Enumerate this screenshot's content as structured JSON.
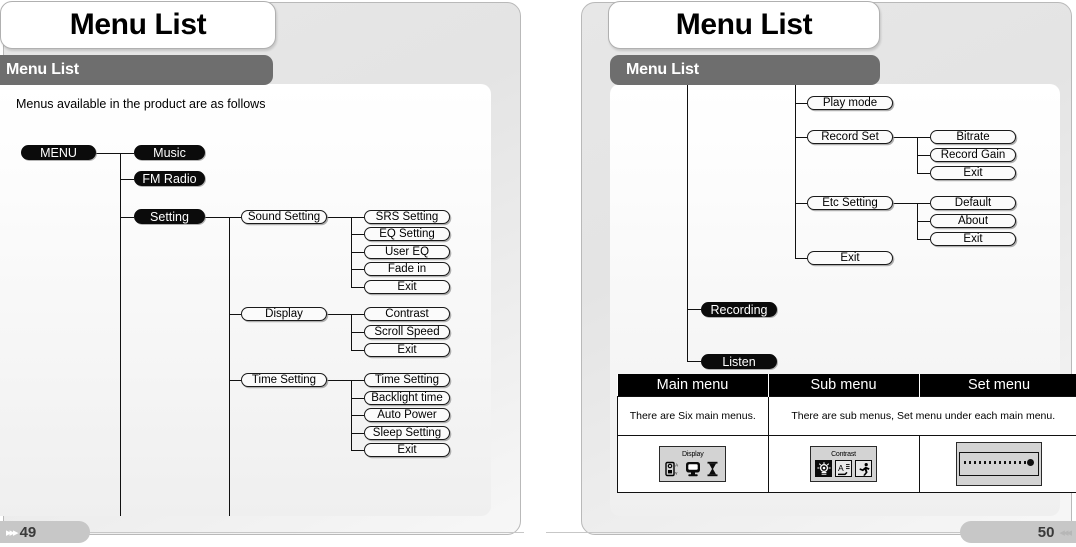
{
  "left_page": {
    "title": "Menu List",
    "section_header": "Menu List",
    "intro": "Menus available in the product are as follows",
    "folio": "49",
    "folio_arrows": "▸▸▸",
    "root": "MENU",
    "main_menus": [
      "Music",
      "FM Radio",
      "Setting"
    ],
    "sub_menus": [
      "Sound Setting",
      "Display",
      "Time Setting"
    ],
    "set_menus": {
      "sound_setting": [
        "SRS Setting",
        "EQ Setting",
        "User EQ",
        "Fade in",
        "Exit"
      ],
      "display": [
        "Contrast",
        "Scroll Speed",
        "Exit"
      ],
      "time_setting": [
        "Time Setting",
        "Backlight time",
        "Auto Power",
        "Sleep Setting",
        "Exit"
      ]
    }
  },
  "right_page": {
    "title": "Menu List",
    "section_header": "Menu List",
    "folio": "50",
    "folio_arrows": "◂◂◂",
    "sub_menus": [
      "Play mode",
      "Record Set",
      "Etc Setting",
      "Exit"
    ],
    "set_menus": {
      "record_set": [
        "Bitrate",
        "Record Gain",
        "Exit"
      ],
      "etc_setting": [
        "Default",
        "About",
        "Exit"
      ]
    },
    "main_menus": [
      "Recording",
      "Listen"
    ],
    "table": {
      "headers": [
        "Main menu",
        "Sub menu",
        "Set menu"
      ],
      "descriptions": [
        "There are Six main menus.",
        "There are sub menus, Set menu under each main menu."
      ],
      "screens": [
        {
          "label": "Display",
          "icons": [
            "player-icon",
            "monitor-icon",
            "hourglass-icon"
          ]
        },
        {
          "label": "Contrast",
          "icons": [
            "brightness-icon",
            "text-icon",
            "running-icon"
          ]
        },
        {
          "label": "",
          "icons": [
            "slider-icon"
          ]
        }
      ]
    }
  },
  "colors": {
    "band": "#6e6e6e",
    "node_main_bg": "#0b0b0b",
    "node_main_fg": "#ffffff",
    "table_header_bg": "#000000",
    "folio_bg": "#c7c7c7",
    "lcd_bg": "#d3d3d3"
  }
}
